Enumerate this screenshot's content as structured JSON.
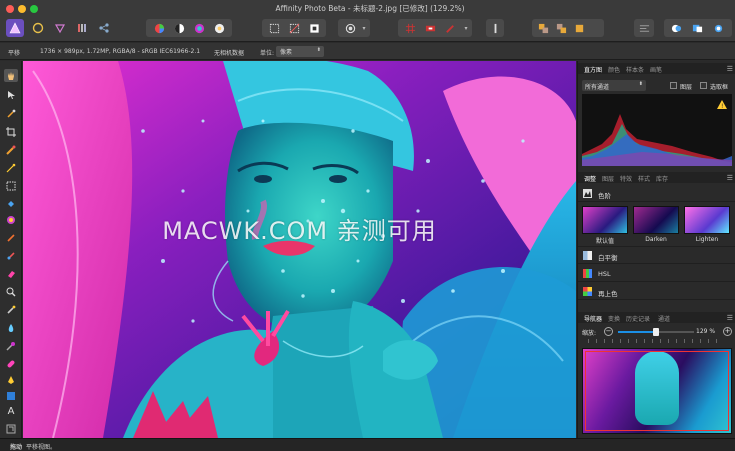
{
  "window": {
    "title": "Affinity Photo Beta - 未标题-2.jpg [已修改] (129.2%)"
  },
  "context": {
    "tool_name": "平移",
    "doc_info": "1736 × 989px, 1.72MP, RGBA/8 - sRGB IEC61966-2.1",
    "no_camera": "无相机数据",
    "unit_label": "单位:",
    "unit_value": "像素"
  },
  "canvas": {
    "watermark": "MACWK.COM 亲测可用"
  },
  "histogram": {
    "tabs": [
      {
        "label": "直方图",
        "active": true
      },
      {
        "label": "颜色",
        "active": false
      },
      {
        "label": "样本条",
        "active": false
      },
      {
        "label": "画笔",
        "active": false
      }
    ],
    "channel": "所有通道",
    "layer_label": "图层",
    "selection_label": "选取框"
  },
  "adjust": {
    "tabs": [
      {
        "label": "调整",
        "active": true
      },
      {
        "label": "图层",
        "active": false
      },
      {
        "label": "特效",
        "active": false
      },
      {
        "label": "样式",
        "active": false
      },
      {
        "label": "库存",
        "active": false
      }
    ],
    "levels": "色阶",
    "presets": [
      "默认值",
      "Darken",
      "Lighten"
    ],
    "items": [
      "白平衡",
      "HSL",
      "再上色"
    ]
  },
  "navigator": {
    "tabs": [
      {
        "label": "导航器",
        "active": true
      },
      {
        "label": "变换",
        "active": false
      },
      {
        "label": "历史记录",
        "active": false
      },
      {
        "label": "通道",
        "active": false
      }
    ],
    "zoom_label": "缩放:",
    "zoom_value": "129 %",
    "zoom_fraction": 0.5
  },
  "status": {
    "bold": "拖动",
    "text": "平移视图。"
  },
  "colors": {
    "accent": "#1b8fe6",
    "panel": "#2a2a2a",
    "canvas_bg": "#6a1a8a"
  }
}
